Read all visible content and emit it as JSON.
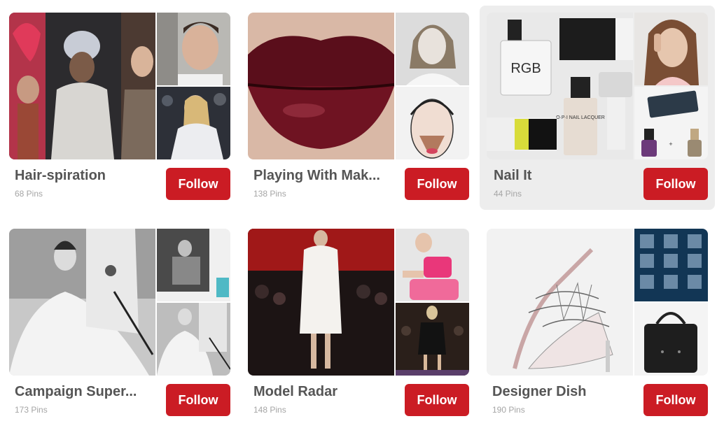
{
  "boards": [
    {
      "title": "Hair-spiration",
      "count": "68 Pins",
      "follow": "Follow"
    },
    {
      "title": "Playing With Mak...",
      "count": "138 Pins",
      "follow": "Follow"
    },
    {
      "title": "Nail It",
      "count": "44 Pins",
      "follow": "Follow"
    },
    {
      "title": "Campaign Super...",
      "count": "173 Pins",
      "follow": "Follow"
    },
    {
      "title": "Model Radar",
      "count": "148 Pins",
      "follow": "Follow"
    },
    {
      "title": "Designer Dish",
      "count": "190 Pins",
      "follow": "Follow"
    }
  ],
  "nail_polish_labels": {
    "rgb": "RGB",
    "opi": "O·P·I NAIL LACQUER"
  },
  "colors": {
    "follow_button": "#cb1c24",
    "title_text": "#555555",
    "count_text": "#a5a5a5",
    "hover_card": "#ededed"
  }
}
